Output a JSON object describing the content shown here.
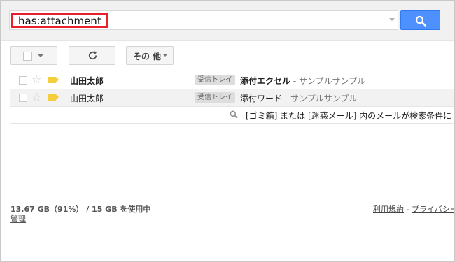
{
  "search": {
    "query": "has:attachment"
  },
  "toolbar": {
    "more_label": "その 他"
  },
  "messages": [
    {
      "sender": "山田太郎",
      "label": "受信トレイ",
      "subject": "添付エクセル",
      "snippet": " - サンプルサンプル",
      "unread": true
    },
    {
      "sender": "山田太郎",
      "label": "受信トレイ",
      "subject": "添付ワード",
      "snippet": " - サンプルサンプル",
      "unread": false
    }
  ],
  "notice": {
    "text": "[ゴミ箱] または [迷惑メール] 内のメールが検索条件に"
  },
  "footer": {
    "quota": "13.67 GB（91%） / 15 GB を使用中",
    "manage": "管理",
    "terms": "利用規約",
    "separator": " - ",
    "privacy": "プライバシー"
  },
  "colors": {
    "search_highlight_border": "#e8202a",
    "search_button": "#4d90fe",
    "label_tag": "#f5ce3d"
  }
}
